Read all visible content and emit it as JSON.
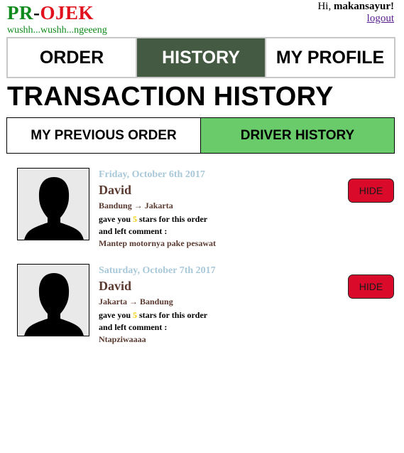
{
  "brand": {
    "pr": "PR",
    "dash": "-",
    "ojek": "OJEK",
    "tagline": "wushh...wushh...ngeeeng"
  },
  "user": {
    "greeting_prefix": "Hi, ",
    "username": "makansayur",
    "greeting_suffix": "!",
    "logout_label": "logout"
  },
  "nav": {
    "tabs": [
      {
        "label": "ORDER"
      },
      {
        "label": "HISTORY"
      },
      {
        "label": "MY PROFILE"
      }
    ],
    "active": "HISTORY"
  },
  "page": {
    "title": "TRANSACTION HISTORY"
  },
  "subtabs": {
    "items": [
      {
        "label": "MY PREVIOUS ORDER"
      },
      {
        "label": "DRIVER HISTORY"
      }
    ],
    "active": "DRIVER HISTORY"
  },
  "history": [
    {
      "date": "Friday, October 6th 2017",
      "name": "David",
      "route": "Bandung → Jakarta",
      "rating_prefix": "gave you ",
      "stars": "5",
      "rating_suffix": " stars for this order",
      "comment_label": "and left comment :",
      "comment": "Mantep motornya pake pesawat",
      "hide_label": "HIDE"
    },
    {
      "date": "Saturday, October 7th 2017",
      "name": "David",
      "route": "Jakarta → Bandung",
      "rating_prefix": "gave you ",
      "stars": "5",
      "rating_suffix": " stars for this order",
      "comment_label": "and left comment :",
      "comment": "Ntapziwaaaa",
      "hide_label": "HIDE"
    }
  ],
  "colors": {
    "brand_green": "#0f8a1c",
    "brand_red": "#e0101d",
    "nav_active": "#445a42",
    "subtab_active": "#69cb6a",
    "hide_button": "#d90a2a",
    "date_text": "#a8c8d8"
  }
}
